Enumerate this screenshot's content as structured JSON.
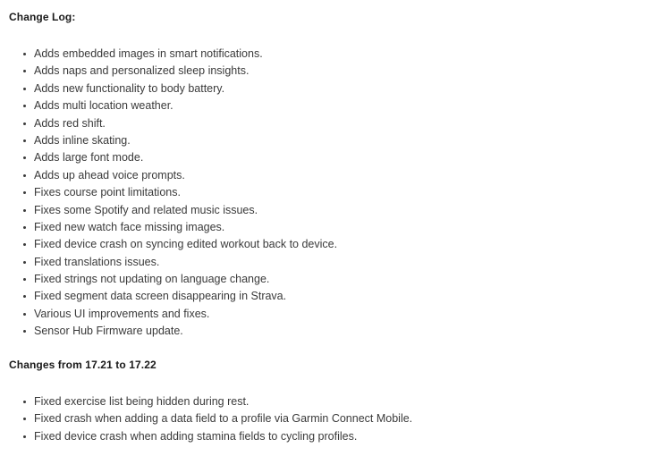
{
  "document": {
    "background_color": "#ffffff",
    "text_color": "#3a3a3a",
    "heading_color": "#1a1a1a"
  },
  "sections": [
    {
      "heading": "Change Log:",
      "items": [
        "Adds embedded images in smart notifications.",
        "Adds naps and personalized sleep insights.",
        "Adds new functionality to body battery.",
        "Adds multi location weather.",
        "Adds red shift.",
        "Adds inline skating.",
        "Adds large font mode.",
        "Adds up ahead voice prompts.",
        "Fixes course point limitations.",
        "Fixes some Spotify and related music issues.",
        "Fixed new watch face missing images.",
        "Fixed device crash on syncing edited workout back to device.",
        "Fixed translations issues.",
        "Fixed strings not updating on language change.",
        "Fixed segment data screen disappearing in Strava.",
        "Various UI improvements and fixes.",
        "Sensor Hub Firmware update."
      ]
    },
    {
      "heading": "Changes from 17.21 to 17.22",
      "items": [
        "Fixed exercise list being hidden during rest.",
        "Fixed crash when adding a data field to a profile via Garmin Connect Mobile.",
        "Fixed device crash when adding stamina fields to cycling profiles."
      ]
    }
  ]
}
